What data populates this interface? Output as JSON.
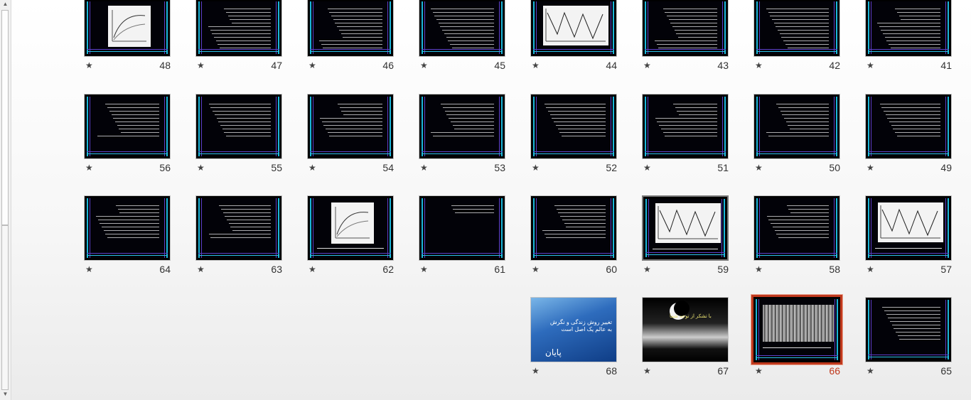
{
  "scrollbar": {
    "up_icon": "triangle-up-icon",
    "down_icon": "triangle-down-icon"
  },
  "star_glyph": "★",
  "slides": [
    {
      "num": "48",
      "style": "chart"
    },
    {
      "num": "47",
      "style": "text"
    },
    {
      "num": "46",
      "style": "text"
    },
    {
      "num": "45",
      "style": "text"
    },
    {
      "num": "44",
      "style": "diagram"
    },
    {
      "num": "43",
      "style": "text"
    },
    {
      "num": "42",
      "style": "text"
    },
    {
      "num": "41",
      "style": "text"
    },
    {
      "num": "56",
      "style": "text"
    },
    {
      "num": "55",
      "style": "text"
    },
    {
      "num": "54",
      "style": "text"
    },
    {
      "num": "53",
      "style": "text"
    },
    {
      "num": "52",
      "style": "text"
    },
    {
      "num": "51",
      "style": "text"
    },
    {
      "num": "50",
      "style": "text"
    },
    {
      "num": "49",
      "style": "text"
    },
    {
      "num": "64",
      "style": "text"
    },
    {
      "num": "63",
      "style": "text"
    },
    {
      "num": "62",
      "style": "chart"
    },
    {
      "num": "61",
      "style": "table"
    },
    {
      "num": "60",
      "style": "text"
    },
    {
      "num": "59",
      "style": "diagram"
    },
    {
      "num": "58",
      "style": "text"
    },
    {
      "num": "57",
      "style": "diagram"
    },
    {
      "num": "68",
      "style": "blue"
    },
    {
      "num": "67",
      "style": "moon"
    },
    {
      "num": "66",
      "style": "photo"
    },
    {
      "num": "65",
      "style": "text"
    }
  ],
  "slide68": {
    "line1": "تغییر روش زندگی و نگرش به عالم یک اصل است",
    "line2": "پایان"
  },
  "slide67": {
    "line1": "با تشکر از توجه شما"
  },
  "selected_slide": "66",
  "colors": {
    "selected_border": "#c0391d",
    "accent_bar": "#1ab6d9",
    "purple_bar": "#5d3fc8"
  }
}
